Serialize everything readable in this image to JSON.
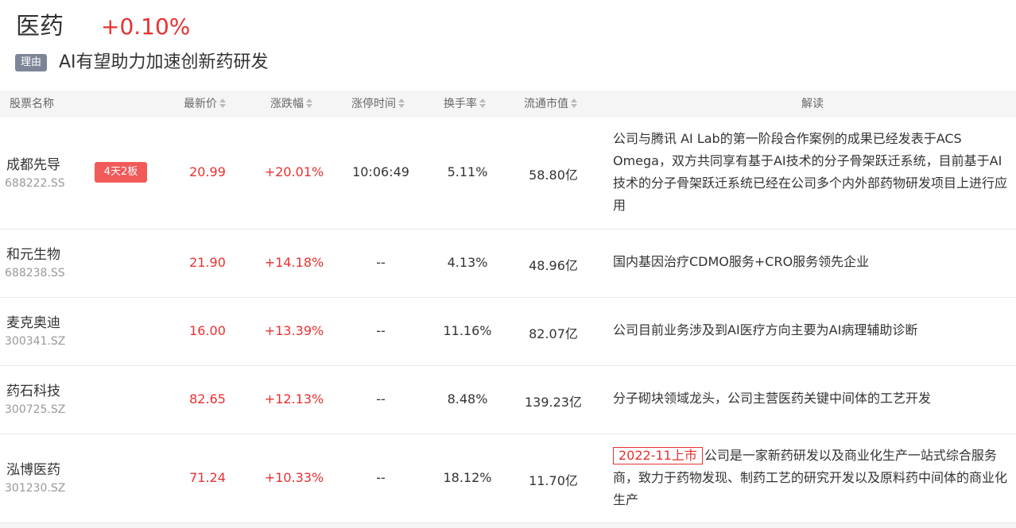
{
  "sector": {
    "title": "医药",
    "change": "+0.10%"
  },
  "reason": {
    "tag": "理由",
    "text": "AI有望助力加速创新药研发"
  },
  "columns": {
    "name": "股票名称",
    "price": "最新价",
    "change": "涨跌幅",
    "limit_time": "涨停时间",
    "turnover": "换手率",
    "market_cap": "流通市值",
    "desc": "解读"
  },
  "rows": [
    {
      "name": "成都先导",
      "code": "688222.SS",
      "badge": "4天2板",
      "price": "20.99",
      "change": "+20.01%",
      "limit_time": "10:06:49",
      "turnover": "5.11%",
      "market_cap": "58.80亿",
      "desc_tag": "",
      "desc": "公司与腾讯 AI Lab的第一阶段合作案例的成果已经发表于ACS Omega，双方共同享有基于AI技术的分子骨架跃迁系统，目前基于AI技术的分子骨架跃迁系统已经在公司多个内外部药物研发项目上进行应用"
    },
    {
      "name": "和元生物",
      "code": "688238.SS",
      "badge": "",
      "price": "21.90",
      "change": "+14.18%",
      "limit_time": "--",
      "turnover": "4.13%",
      "market_cap": "48.96亿",
      "desc_tag": "",
      "desc": "国内基因治疗CDMO服务+CRO服务领先企业"
    },
    {
      "name": "麦克奥迪",
      "code": "300341.SZ",
      "badge": "",
      "price": "16.00",
      "change": "+13.39%",
      "limit_time": "--",
      "turnover": "11.16%",
      "market_cap": "82.07亿",
      "desc_tag": "",
      "desc": "公司目前业务涉及到AI医疗方向主要为AI病理辅助诊断"
    },
    {
      "name": "药石科技",
      "code": "300725.SZ",
      "badge": "",
      "price": "82.65",
      "change": "+12.13%",
      "limit_time": "--",
      "turnover": "8.48%",
      "market_cap": "139.23亿",
      "desc_tag": "",
      "desc": "分子砌块领域龙头，公司主营医药关键中间体的工艺开发"
    },
    {
      "name": "泓博医药",
      "code": "301230.SZ",
      "badge": "",
      "price": "71.24",
      "change": "+10.33%",
      "limit_time": "--",
      "turnover": "18.12%",
      "market_cap": "11.70亿",
      "desc_tag": "2022-11上市",
      "desc": "公司是一家新药研发以及商业化生产一站式综合服务商，致力于药物发现、制药工艺的研究开发以及原料药中间体的商业化生产"
    }
  ]
}
